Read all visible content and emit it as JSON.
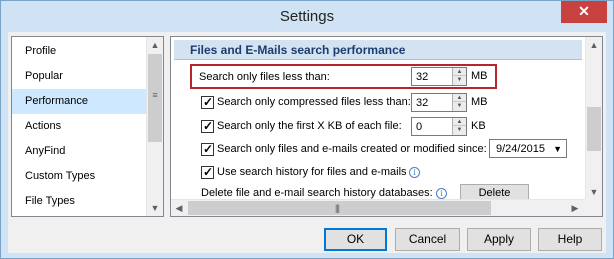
{
  "window": {
    "title": "Settings",
    "close_label": "✕"
  },
  "nav": {
    "items": [
      {
        "label": "Profile",
        "selected": false
      },
      {
        "label": "Popular",
        "selected": false
      },
      {
        "label": "Performance",
        "selected": true
      },
      {
        "label": "Actions",
        "selected": false
      },
      {
        "label": "AnyFind",
        "selected": false
      },
      {
        "label": "Custom Types",
        "selected": false
      },
      {
        "label": "File Types",
        "selected": false
      }
    ]
  },
  "panel": {
    "section_title": "Files and E-Mails search performance",
    "size_limit": {
      "label": "Search only files less than:",
      "value": "32",
      "unit": "MB"
    },
    "compressed_limit": {
      "label": "Search only compressed files less than:",
      "value": "32",
      "unit": "MB",
      "checked": true
    },
    "first_kb": {
      "label": "Search only the first X KB of each file:",
      "value": "0",
      "unit": "KB",
      "checked": true
    },
    "date_filter": {
      "label": "Search only files and e-mails created or modified since:",
      "value": "9/24/2015",
      "checked": true
    },
    "history": {
      "label": "Use search history for files and e-mails",
      "checked": true
    },
    "delete_history": {
      "label": "Delete file and e-mail search history databases:",
      "button_label": "Delete"
    }
  },
  "buttons": {
    "ok": "OK",
    "cancel": "Cancel",
    "apply": "Apply",
    "help": "Help"
  },
  "colors": {
    "selected_nav": "#cde8ff",
    "highlight_border": "#b5252a",
    "close_button": "#c7413e"
  }
}
